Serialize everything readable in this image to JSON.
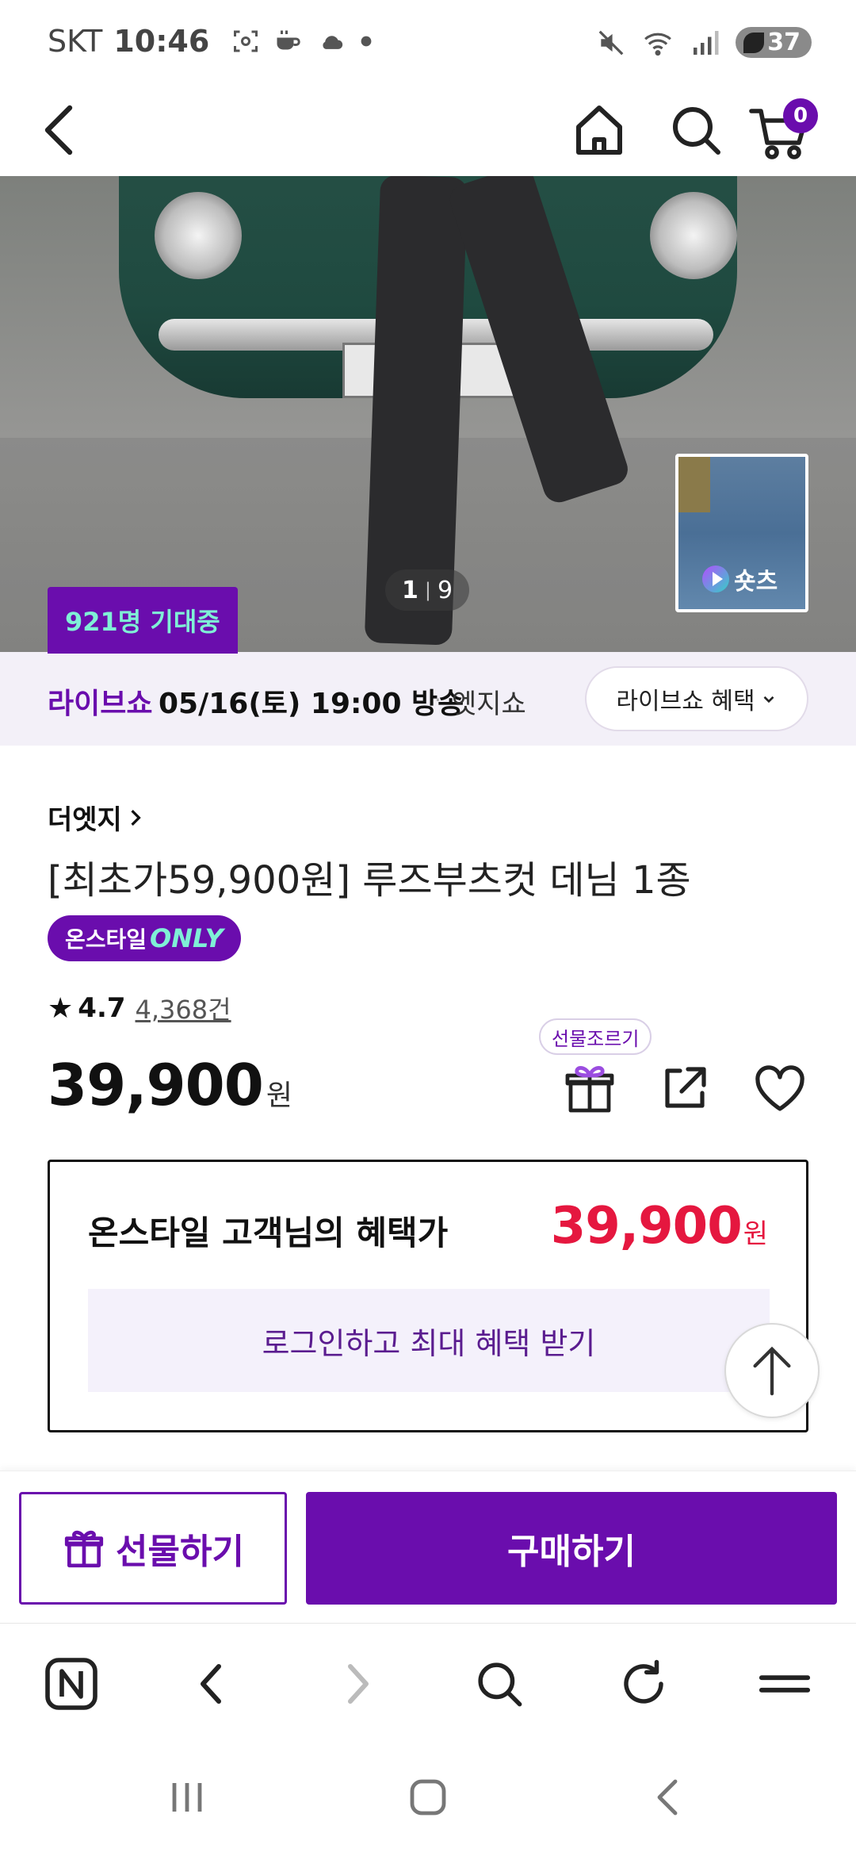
{
  "status_bar": {
    "carrier": "SKT",
    "time": "10:46",
    "battery": "37"
  },
  "top_nav": {
    "cart_count": "0"
  },
  "hero": {
    "page_current": "1",
    "page_separator": "|",
    "page_total": "9",
    "shorts_label": "숏츠",
    "expect_badge": "921명 기대중"
  },
  "live": {
    "label": "라이브쇼",
    "date": "05/16(토) 19:00 방송",
    "dot": "·",
    "host": "엣지쇼",
    "benefit_button": "라이브쇼 혜택"
  },
  "product": {
    "brand": "더엣지",
    "brand_chevron": "›",
    "title": "[최초가59,900원] 루즈부츠컷 데님 1종",
    "badge_prefix": "온스타일",
    "badge_only": "ONLY",
    "rating_star": "★",
    "rating": "4.7",
    "review_count": "4,368건",
    "price": "39,900",
    "price_unit": "원",
    "gift_tip": "선물조르기"
  },
  "benefit": {
    "title": "온스타일 고객님의 혜택가",
    "price": "39,900",
    "price_unit": "원",
    "login_cta": "로그인하고 최대 혜택 받기"
  },
  "actions": {
    "gift": "선물하기",
    "buy": "구매하기"
  },
  "colors": {
    "brand_purple": "#6a0dad",
    "mint": "#7ff0d6",
    "sale_red": "#e5173f"
  }
}
